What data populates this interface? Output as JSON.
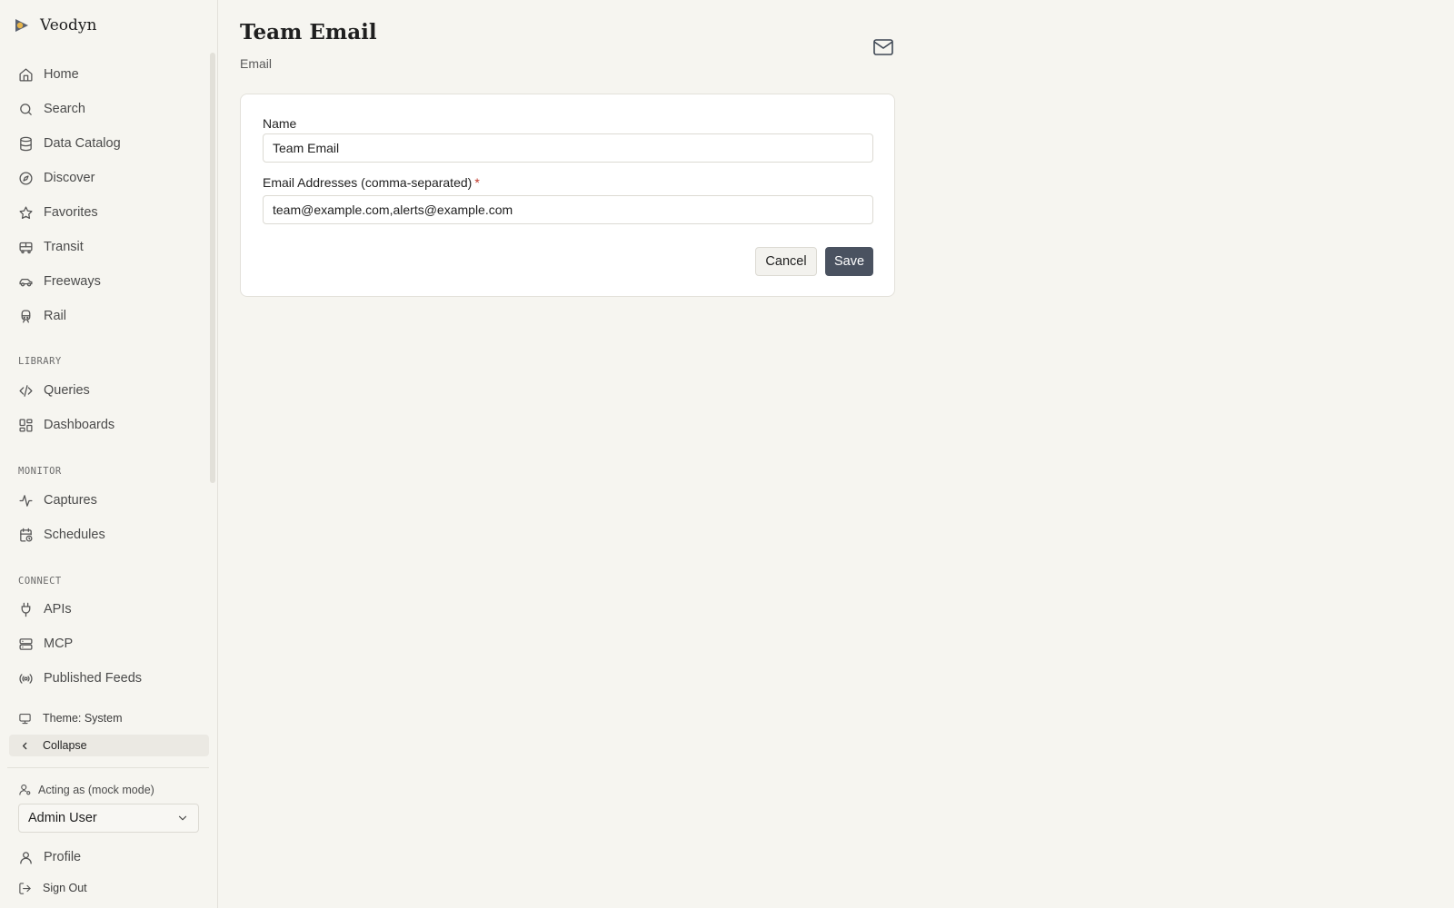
{
  "brand": {
    "name": "Veodyn",
    "accent": "#e8b54a"
  },
  "sidebar": {
    "primary": [
      {
        "label": "Home",
        "icon": "home-icon"
      },
      {
        "label": "Search",
        "icon": "search-icon"
      },
      {
        "label": "Data Catalog",
        "icon": "database-icon"
      },
      {
        "label": "Discover",
        "icon": "compass-icon"
      },
      {
        "label": "Favorites",
        "icon": "star-icon"
      },
      {
        "label": "Transit",
        "icon": "bus-icon"
      },
      {
        "label": "Freeways",
        "icon": "car-icon"
      },
      {
        "label": "Rail",
        "icon": "train-icon"
      }
    ],
    "sections": [
      {
        "title": "LIBRARY",
        "items": [
          {
            "label": "Queries",
            "icon": "code-icon"
          },
          {
            "label": "Dashboards",
            "icon": "dashboard-icon"
          }
        ]
      },
      {
        "title": "MONITOR",
        "items": [
          {
            "label": "Captures",
            "icon": "activity-icon"
          },
          {
            "label": "Schedules",
            "icon": "calendar-clock-icon"
          }
        ]
      },
      {
        "title": "CONNECT",
        "items": [
          {
            "label": "APIs",
            "icon": "plug-icon"
          },
          {
            "label": "MCP",
            "icon": "server-icon"
          },
          {
            "label": "Published Feeds",
            "icon": "broadcast-icon"
          }
        ]
      }
    ],
    "theme_label": "Theme: System",
    "collapse_label": "Collapse",
    "acting_label": "Acting as (mock mode)",
    "acting_user": "Admin User",
    "profile_label": "Profile",
    "signout_label": "Sign Out"
  },
  "page": {
    "title": "Team Email",
    "subtitle": "Email",
    "header_icon": "mail-icon"
  },
  "form": {
    "name_label": "Name",
    "name_value": "Team Email",
    "emails_label": "Email Addresses (comma-separated)",
    "required_marker": "*",
    "emails_value": "team@example.com,alerts@example.com",
    "cancel_label": "Cancel",
    "save_label": "Save"
  },
  "colors": {
    "background": "#f6f5f0",
    "save_button": "#4a5260",
    "required": "#c0392b"
  }
}
